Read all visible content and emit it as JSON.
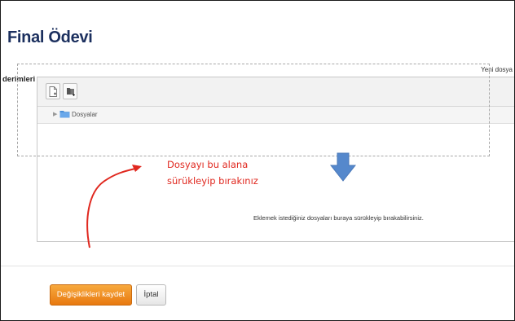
{
  "page": {
    "title": "Final Ödevi"
  },
  "form": {
    "field_label": "derimleri",
    "max_size_text": "Yeni dosya"
  },
  "filemanager": {
    "toolbar": {
      "add_file_icon": "add-file-icon",
      "create_folder_icon": "create-folder-icon"
    },
    "path": {
      "folder_label": "Dosyalar",
      "folder_icon": "folder-icon"
    },
    "dropzone": {
      "text": "Eklemek istediğiniz dosyaları buraya sürükleyip bırakabilirsiniz.",
      "arrow_icon": "down-arrow-icon"
    }
  },
  "annotation": {
    "line1": "Dosyayı bu alana",
    "line2": "sürükleyip bırakınız",
    "color": "#e0281f"
  },
  "actions": {
    "save_label": "Değişiklikleri kaydet",
    "cancel_label": "İptal",
    "save_color": "#f09a2a"
  }
}
